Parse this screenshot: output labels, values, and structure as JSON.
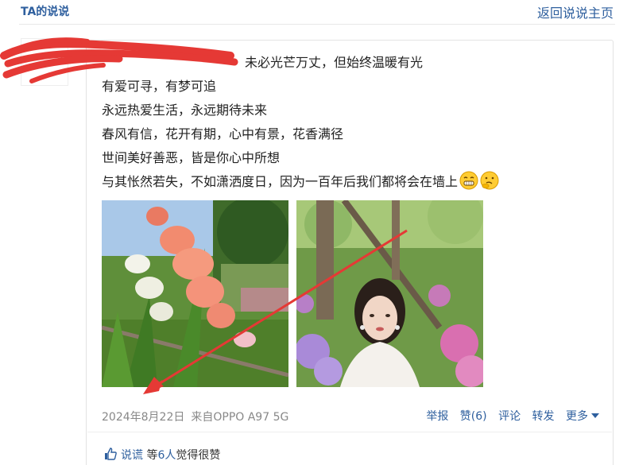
{
  "header": {
    "title": "TA的说说",
    "back_link": "返回说说主页"
  },
  "post": {
    "lines": [
      "未必光芒万丈，但始终温暖有光",
      "有爱可寻，有梦可追",
      "永远热爱生活，永远期待未来",
      "春风有信，花开有期，心中有景，花香满径",
      "世间美好善恶，皆是你心中所想",
      "与其怅然若失，不如潇洒度日，因为一百年后我们都将会在墙上"
    ],
    "emojis": [
      "grin-emoji",
      "thinking-emoji"
    ],
    "images": [
      "gladiolus-flowers-photo",
      "woman-in-garden-photo"
    ]
  },
  "meta": {
    "date": "2024年8月22日",
    "source": "来自OPPO A97 5G"
  },
  "actions": {
    "report": "举报",
    "like": "赞(6)",
    "comment": "评论",
    "forward": "转发",
    "more": "更多"
  },
  "likes": {
    "name": "说谎",
    "middle": "等",
    "count": "6人",
    "suffix": "觉得很赞"
  },
  "colors": {
    "link": "#2e5f9e",
    "annotation": "#e53935"
  }
}
